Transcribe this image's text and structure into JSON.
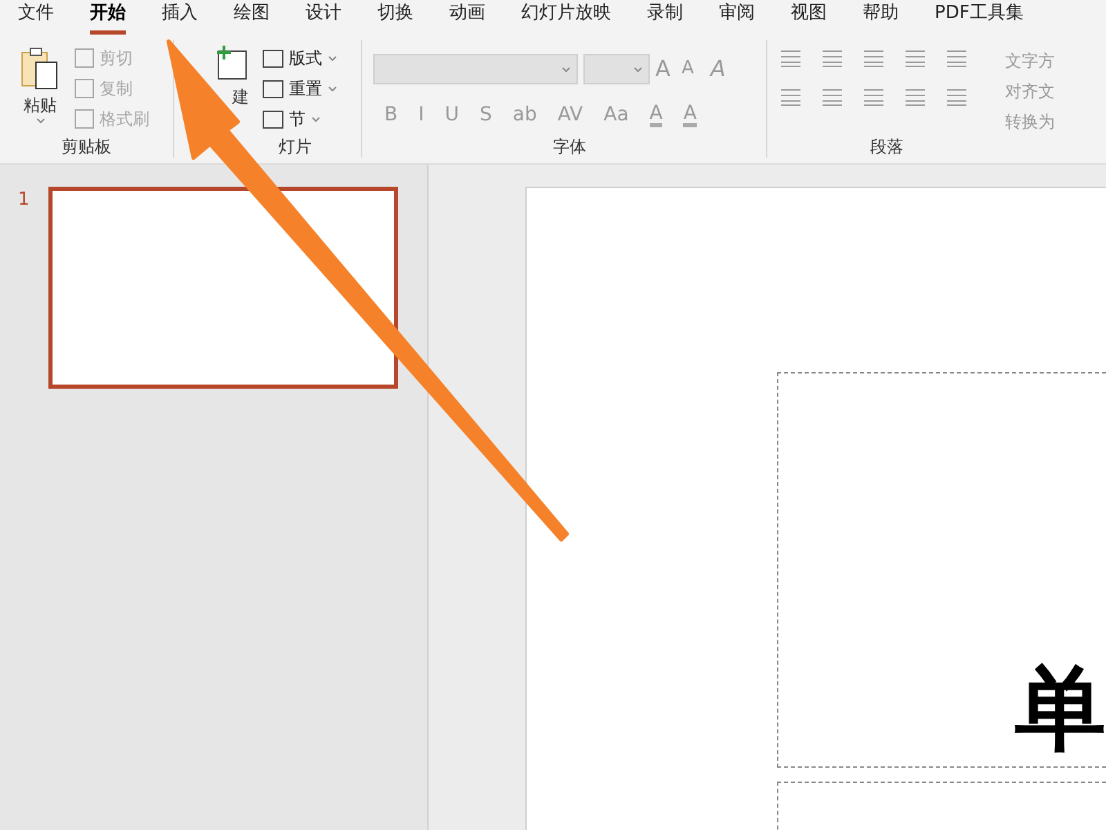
{
  "tabs": [
    {
      "label": "文件",
      "selected": false
    },
    {
      "label": "开始",
      "selected": true
    },
    {
      "label": "插入",
      "selected": false
    },
    {
      "label": "绘图",
      "selected": false
    },
    {
      "label": "设计",
      "selected": false
    },
    {
      "label": "切换",
      "selected": false
    },
    {
      "label": "动画",
      "selected": false
    },
    {
      "label": "幻灯片放映",
      "selected": false
    },
    {
      "label": "录制",
      "selected": false
    },
    {
      "label": "审阅",
      "selected": false
    },
    {
      "label": "视图",
      "selected": false
    },
    {
      "label": "帮助",
      "selected": false
    },
    {
      "label": "PDF工具集",
      "selected": false
    }
  ],
  "clipboard": {
    "paste": "粘贴",
    "group": "剪贴板",
    "commands": [
      {
        "label": "剪切",
        "disabled": true
      },
      {
        "label": "复制",
        "disabled": true
      },
      {
        "label": "格式刷",
        "disabled": true
      }
    ]
  },
  "slides_group": {
    "new_slide": "建",
    "group": "灯片",
    "commands": [
      "版式",
      "重置",
      "节"
    ]
  },
  "font_group": {
    "group": "字体",
    "grow": "A",
    "shrink": "A",
    "clear": "A",
    "format_buttons": [
      "B",
      "I",
      "U",
      "S",
      "ab",
      "AV",
      "Aa"
    ],
    "highlight": "A",
    "font_color": "A"
  },
  "paragraph_group": {
    "group": "段落",
    "side_commands": [
      "文字方",
      "对齐文",
      "转换为"
    ]
  },
  "slide_panel": [
    {
      "number": "1",
      "selected": true
    }
  ],
  "slide": {
    "title": "单"
  }
}
